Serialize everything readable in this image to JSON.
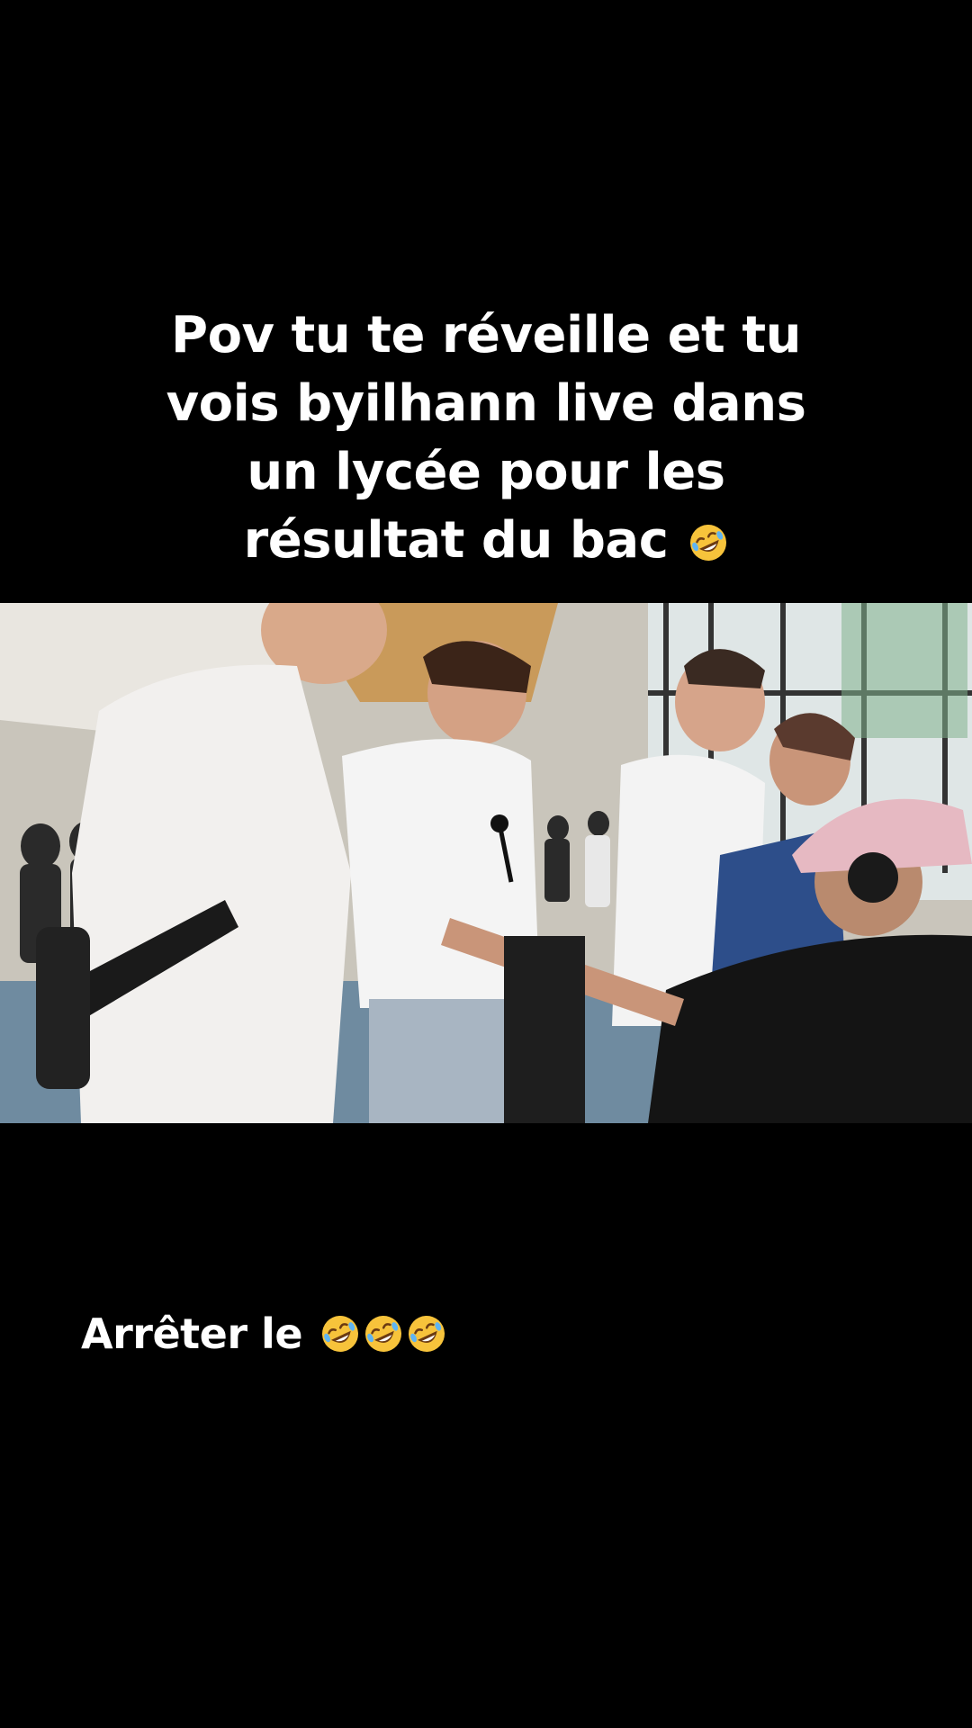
{
  "caption_top": {
    "lines": [
      "Pov tu te réveille et tu",
      "vois byilhann live dans",
      "un lycée pour les",
      "résultat du bac"
    ],
    "trailing_emoji": "rolling-on-floor-laughing"
  },
  "video": {
    "description_icon": "photo-frame-school-hall",
    "timestamp_overlay": ""
  },
  "caption_bottom": {
    "text": "Arrêter le",
    "emoji_count": 3,
    "emoji": "rolling-on-floor-laughing"
  }
}
